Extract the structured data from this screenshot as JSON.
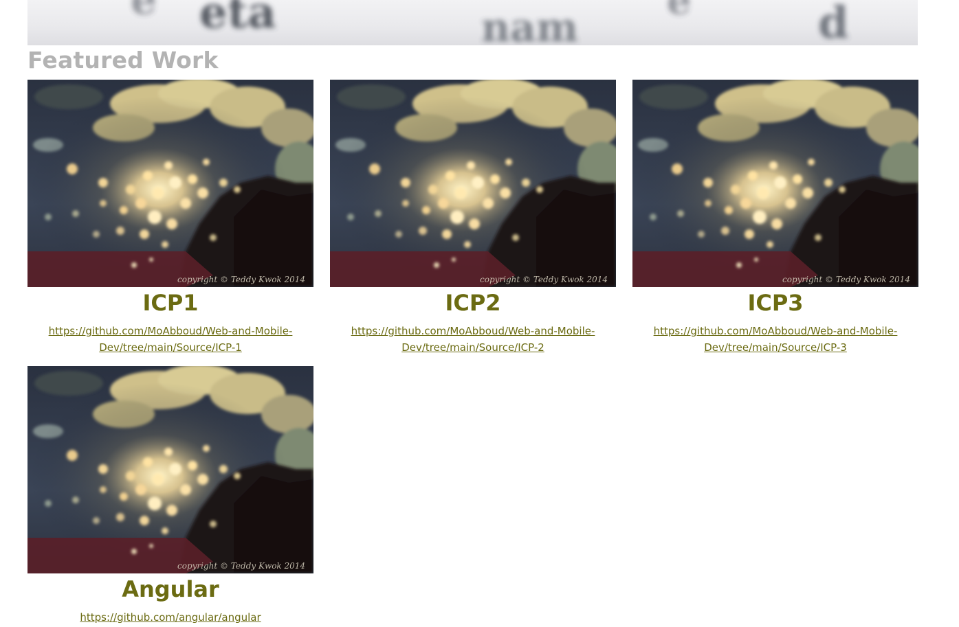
{
  "section": {
    "title": "Featured Work"
  },
  "image": {
    "watermark": "copyright © Teddy Kwok 2014"
  },
  "projects": [
    {
      "title": "ICP1",
      "link": "https://github.com/MoAbboud/Web-and-Mobile-Dev/tree/main/Source/ICP-1"
    },
    {
      "title": "ICP2",
      "link": "https://github.com/MoAbboud/Web-and-Mobile-Dev/tree/main/Source/ICP-2"
    },
    {
      "title": "ICP3",
      "link": "https://github.com/MoAbboud/Web-and-Mobile-Dev/tree/main/Source/ICP-3"
    },
    {
      "title": "Angular",
      "link": "https://github.com/angular/angular"
    }
  ],
  "colors": {
    "title_gray": "#b3b3b3",
    "accent_olive": "#6b6b12"
  }
}
